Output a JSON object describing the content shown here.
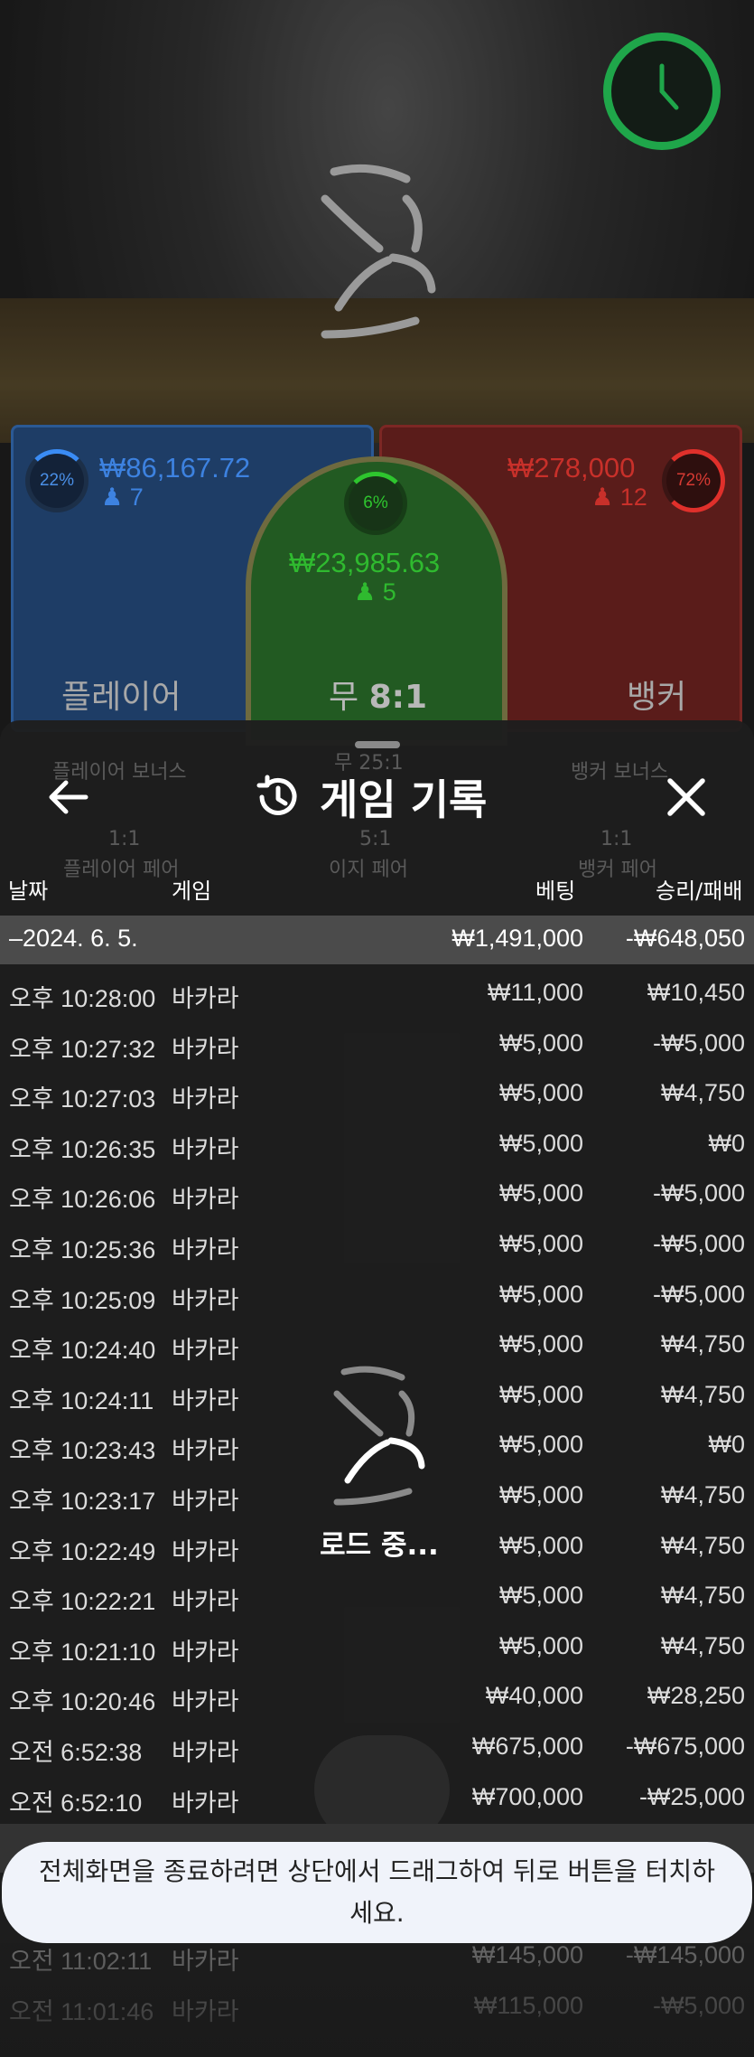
{
  "game": {
    "timer_icon": "clock-icon",
    "player": {
      "pct": "22%",
      "amount": "₩86,167.72",
      "count": "7",
      "label": "플레이어"
    },
    "tie": {
      "pct": "6%",
      "amount": "₩23,985.63",
      "count": "5",
      "label": "무",
      "odds": "8:1"
    },
    "banker": {
      "pct": "72%",
      "amount": "₩278,000",
      "count": "12",
      "label": "뱅커"
    },
    "ghost_labels": [
      "플레이어 보너스",
      "무 25:1",
      "뱅커 보너스",
      "1:1",
      "5:1",
      "1:1",
      "플레이어 페어",
      "이지 페어",
      "뱅커 페어"
    ]
  },
  "history": {
    "title": "게임 기록",
    "columns": {
      "date": "날짜",
      "game": "게임",
      "bet": "베팅",
      "result": "승리/패배"
    },
    "day1": {
      "date": "2024. 6. 5.",
      "bet": "₩1,491,000",
      "result": "-₩648,050"
    },
    "rows": [
      {
        "time": "오후 10:28:00",
        "game": "바카라",
        "bet": "₩11,000",
        "result": "₩10,450"
      },
      {
        "time": "오후 10:27:32",
        "game": "바카라",
        "bet": "₩5,000",
        "result": "-₩5,000"
      },
      {
        "time": "오후 10:27:03",
        "game": "바카라",
        "bet": "₩5,000",
        "result": "₩4,750"
      },
      {
        "time": "오후 10:26:35",
        "game": "바카라",
        "bet": "₩5,000",
        "result": "₩0"
      },
      {
        "time": "오후 10:26:06",
        "game": "바카라",
        "bet": "₩5,000",
        "result": "-₩5,000"
      },
      {
        "time": "오후 10:25:36",
        "game": "바카라",
        "bet": "₩5,000",
        "result": "-₩5,000"
      },
      {
        "time": "오후 10:25:09",
        "game": "바카라",
        "bet": "₩5,000",
        "result": "-₩5,000"
      },
      {
        "time": "오후 10:24:40",
        "game": "바카라",
        "bet": "₩5,000",
        "result": "₩4,750"
      },
      {
        "time": "오후 10:24:11",
        "game": "바카라",
        "bet": "₩5,000",
        "result": "₩4,750"
      },
      {
        "time": "오후 10:23:43",
        "game": "바카라",
        "bet": "₩5,000",
        "result": "₩0"
      },
      {
        "time": "오후 10:23:17",
        "game": "바카라",
        "bet": "₩5,000",
        "result": "₩4,750"
      },
      {
        "time": "오후 10:22:49",
        "game": "바카라",
        "bet": "₩5,000",
        "result": "₩4,750"
      },
      {
        "time": "오후 10:22:21",
        "game": "바카라",
        "bet": "₩5,000",
        "result": "₩4,750"
      },
      {
        "time": "오후 10:21:10",
        "game": "바카라",
        "bet": "₩5,000",
        "result": "₩4,750"
      },
      {
        "time": "오후 10:20:46",
        "game": "바카라",
        "bet": "₩40,000",
        "result": "₩28,250"
      },
      {
        "time": "오전 6:52:38",
        "game": "바카라",
        "bet": "₩675,000",
        "result": "-₩675,000"
      },
      {
        "time": "오전 6:52:10",
        "game": "바카라",
        "bet": "₩700,000",
        "result": "-₩25,000"
      }
    ],
    "below_rows": [
      {
        "time": "오전 11:02:11",
        "game": "바카라",
        "bet": "₩145,000",
        "result": "-₩145,000"
      },
      {
        "time": "오전 11:01:46",
        "game": "바카라",
        "bet": "₩115,000",
        "result": "-₩5,000"
      }
    ],
    "loading_text": "로드 중..."
  },
  "toast": {
    "text": "전체화면을 종료하려면 상단에서 드래그하여 뒤로 버튼을 터치하세요."
  },
  "colors": {
    "player": "#3d82e0",
    "banker": "#c8302a",
    "tie": "#2fba2f",
    "timer": "#1fa64a"
  }
}
